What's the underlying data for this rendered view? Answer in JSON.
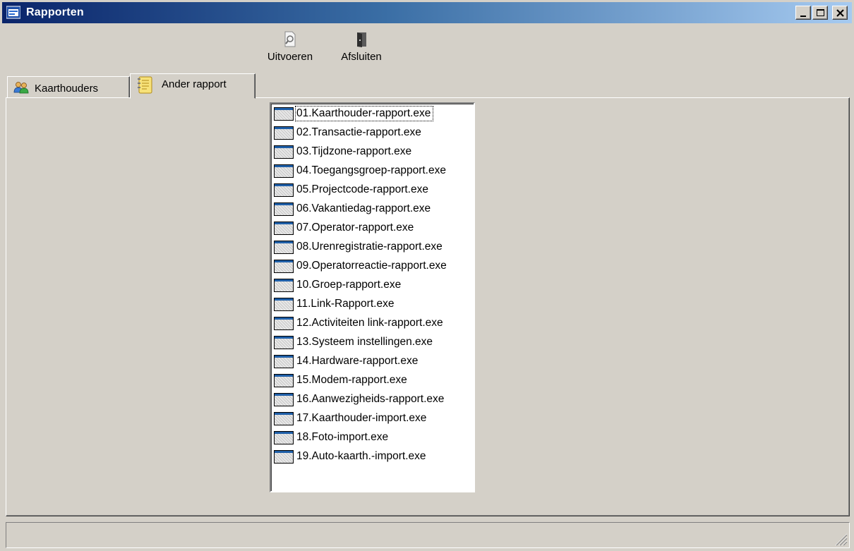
{
  "window": {
    "title": "Rapporten",
    "controls": {
      "minimize": "minimize-icon",
      "maximize": "maximize-icon",
      "close": "close-icon"
    }
  },
  "toolbar": {
    "run_label": "Uitvoeren",
    "run_icon": "magnify-page-icon",
    "exit_label": "Afsluiten",
    "exit_icon": "door-exit-icon"
  },
  "tabs": [
    {
      "label": "Kaarthouders",
      "icon": "users-icon",
      "active": false
    },
    {
      "label": "Ander rapport",
      "icon": "notebook-icon",
      "active": true
    }
  ],
  "report_list": {
    "selected_index": 0,
    "items": [
      "01.Kaarthouder-rapport.exe",
      "02.Transactie-rapport.exe",
      "03.Tijdzone-rapport.exe",
      "04.Toegangsgroep-rapport.exe",
      "05.Projectcode-rapport.exe",
      "06.Vakantiedag-rapport.exe",
      "07.Operator-rapport.exe",
      "08.Urenregistratie-rapport.exe",
      "09.Operatorreactie-rapport.exe",
      "10.Groep-rapport.exe",
      "11.Link-Rapport.exe",
      "12.Activiteiten link-rapport.exe",
      "13.Systeem instellingen.exe",
      "14.Hardware-rapport.exe",
      "15.Modem-rapport.exe",
      "16.Aanwezigheids-rapport.exe",
      "17.Kaarthouder-import.exe",
      "18.Foto-import.exe",
      "19.Auto-kaarth.-import.exe"
    ]
  },
  "statusbar": {
    "text": ""
  }
}
